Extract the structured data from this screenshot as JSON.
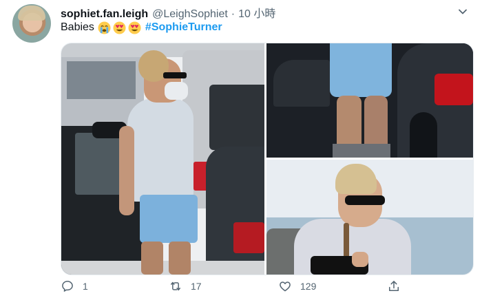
{
  "tweet": {
    "display_name": "sophiet.fan.leigh",
    "handle": "@LeighSophiet",
    "separator": "·",
    "time": "10 小時",
    "text": "Babies",
    "hashtag": "#SophieTurner",
    "emojis": [
      "crying-face",
      "heart-eyes",
      "heart-eyes"
    ]
  },
  "actions": {
    "reply_count": "1",
    "retweet_count": "17",
    "like_count": "129"
  },
  "colors": {
    "link": "#1d9bf0",
    "muted": "#536471",
    "text": "#0f1419"
  }
}
